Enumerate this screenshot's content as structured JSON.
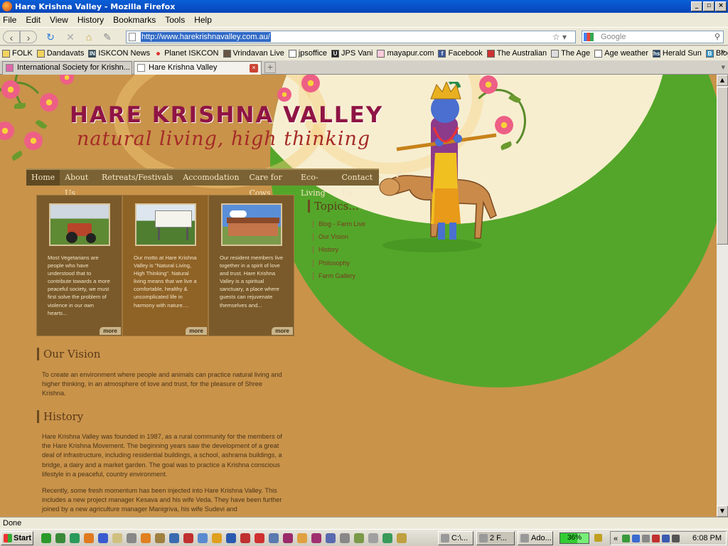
{
  "window": {
    "title": "Hare Krishna Valley - Mozilla Firefox"
  },
  "menu": [
    "File",
    "Edit",
    "View",
    "History",
    "Bookmarks",
    "Tools",
    "Help"
  ],
  "nav": {
    "url": "http://www.harekrishnavalley.com.au/",
    "search_placeholder": "Google"
  },
  "bookmarks": [
    {
      "label": "FOLK",
      "icon": "folder-icon"
    },
    {
      "label": "Dandavats",
      "icon": "rss-icon"
    },
    {
      "label": "ISKCON News",
      "icon": "in-logo-icon"
    },
    {
      "label": "Planet ISKCON",
      "icon": "dots-icon"
    },
    {
      "label": "Vrindavan Live",
      "icon": "tv-icon"
    },
    {
      "label": "jpsoffice",
      "icon": "page-icon"
    },
    {
      "label": "JPS Vani",
      "icon": "u-logo-icon"
    },
    {
      "label": "mayapur.com",
      "icon": "flower-icon"
    },
    {
      "label": "Facebook",
      "icon": "facebook-icon"
    },
    {
      "label": "The Australian",
      "icon": "leaf-icon"
    },
    {
      "label": "The Age",
      "icon": "news-icon"
    },
    {
      "label": "Age weather",
      "icon": "page-icon"
    },
    {
      "label": "Herald Sun",
      "icon": "hs-logo-icon"
    },
    {
      "label": "Bloglines",
      "icon": "b-logo-icon"
    }
  ],
  "tabs": [
    {
      "label": "International Society for Krishn...",
      "active": false
    },
    {
      "label": "Hare Krishna Valley",
      "active": true
    }
  ],
  "site": {
    "title": "HARE KRISHNA VALLEY",
    "tagline": "natural living, high thinking",
    "nav": [
      "Home",
      "About Us",
      "Retreats/Festivals",
      "Accomodation",
      "Care for Cows",
      "Eco-Living",
      "Contact Us"
    ],
    "cards": [
      {
        "text": "Most Vegetarians are people who have understood that to contribute towards a more peaceful society, we must first solve the problem of violence in our own hearts...",
        "more": "more"
      },
      {
        "text": "Our motto at Hare Krishna Valley is \"Natural Living, High Thinking\". Natural living means that we live a comfortable, healthy & uncomplicated life in harmony with nature....",
        "more": "more"
      },
      {
        "text": "Our resident members live together in a spirit of love and trust. Hare Krishna Valley is a spiritual sanctuary, a place where guests can rejuvenate themselves and...",
        "more": "more"
      }
    ],
    "topics": {
      "title": "Topics...",
      "items": [
        "Blog - Farm Live",
        "Our Vision",
        "History",
        "Philosophy",
        "Farm Gallery"
      ]
    },
    "vision": {
      "title": "Our Vision",
      "text": "To create an environment where people and animals can practice natural living and higher thinking, in an atmosphere of love and trust, for the pleasure of Shree Krishna."
    },
    "history": {
      "title": "History",
      "p1": "Hare Krishna Valley was founded in 1987, as a rural community for the members of the Hare Krishna Movement. The beginning years saw the development of a great deal of infrastructure, including residential buildings, a school, ashrama buildings, a bridge, a dairy and a market garden. The goal was to practice a Krishna conscious lifestyle in a peaceful, country environment.",
      "p2": "Recently, some fresh momentum has been injected into Hare Krishna Valley. This includes a new project manager Kesava and his wife Veda. They have been further joined by a new agriculture manager Manigriva, his wife Sudevi and"
    }
  },
  "status": "Done",
  "taskbar": {
    "start": "Start",
    "buttons": [
      "C:\\...",
      "2 F...",
      "Ado..."
    ],
    "memory": "36%",
    "clock": "6:08 PM"
  }
}
